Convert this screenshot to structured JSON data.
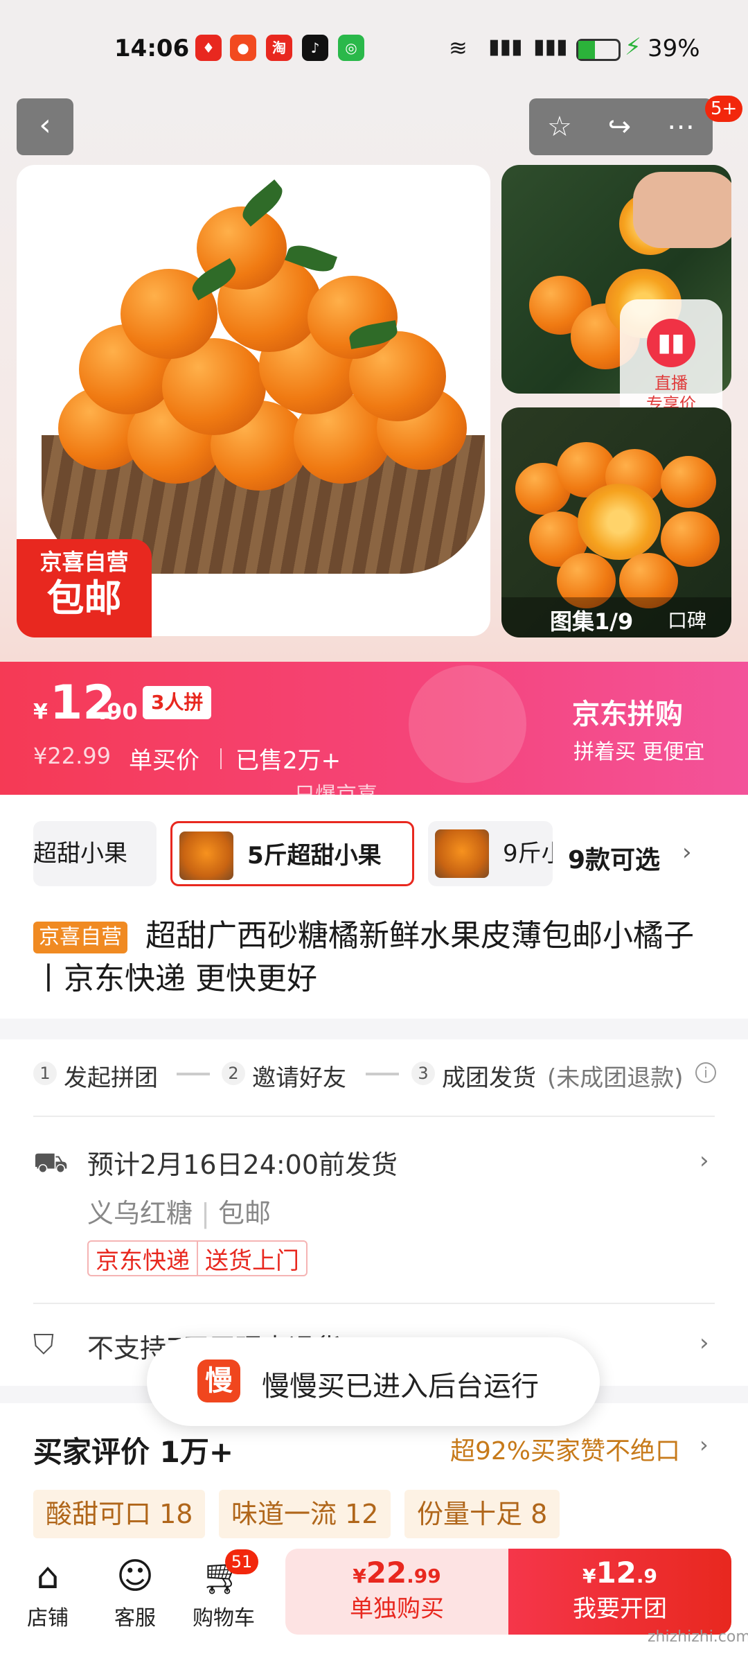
{
  "status_bar": {
    "time": "14:06",
    "battery": "39%"
  },
  "header": {
    "badge": "5+"
  },
  "gallery": {
    "store_badge_line1": "京喜自营",
    "store_badge_line2": "包邮",
    "live_label_line1": "直播",
    "live_label_line2": "专享价",
    "album_counter": "图集1/9",
    "album_tag": "口碑"
  },
  "price": {
    "currency": "¥",
    "integer": "12",
    "decimal": ".90",
    "group_badge": "3人拼",
    "original": "¥22.99",
    "single_label": "单买价",
    "sold": "已售2万+",
    "brand_title": "京东拼购",
    "brand_sub": "拼着买 更便宜",
    "ticker": "只爆京喜"
  },
  "specs": {
    "items": [
      "超甜小果",
      "5斤超甜小果",
      "9斤小"
    ],
    "selected_index": 1,
    "count_label": "9款可选"
  },
  "product": {
    "tag": "京喜自营",
    "title": "超甜广西砂糖橘新鲜水果皮薄包邮小橘子丨京东快递 更快更好"
  },
  "steps": {
    "items": [
      {
        "num": "1",
        "label": "发起拼团"
      },
      {
        "num": "2",
        "label": "邀请好友"
      },
      {
        "num": "3",
        "label": "成团发货"
      }
    ],
    "note": "(未成团退款)"
  },
  "delivery": {
    "date": "预计2月16日24:00前发货",
    "origin": "义乌红糖",
    "shipping": "包邮",
    "tags": [
      "京东快递",
      "送货上门"
    ],
    "return_policy": "不支持7天无理由退货"
  },
  "toast": {
    "icon_char": "慢",
    "text": "慢慢买已进入后台运行"
  },
  "reviews": {
    "title": "买家评价",
    "count": "1万+",
    "praise": "超92%买家赞不绝口",
    "tags": [
      "酸甜可口 18",
      "味道一流 12",
      "份量十足 8"
    ]
  },
  "bottom_bar": {
    "store": "店铺",
    "service": "客服",
    "cart": "购物车",
    "cart_count": "51",
    "single_price_int": "22",
    "single_price_dec": ".99",
    "single_label": "单独购买",
    "group_price_int": "12",
    "group_price_dec": ".9",
    "group_label": "我要开团"
  },
  "watermark": "zhizhizhi.com"
}
